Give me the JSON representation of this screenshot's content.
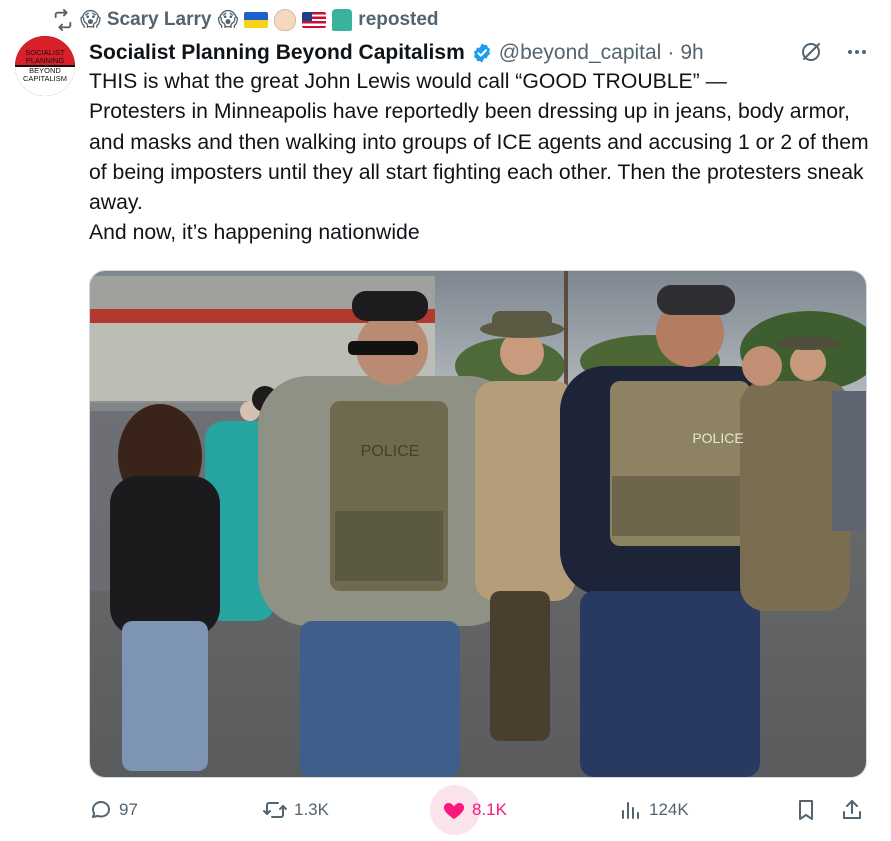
{
  "repost": {
    "user_name": "Scary Larry",
    "label": "reposted",
    "icons": [
      "repost-icon",
      "scream-emoji",
      "ukraine-flag",
      "raised-fist-emoji",
      "us-flag",
      "statue-of-liberty-emoji"
    ]
  },
  "author": {
    "avatar_top_lines": [
      "SOCIALIST",
      "PLANNING"
    ],
    "avatar_bottom_lines": [
      "BEYOND",
      "CAPITALISM"
    ],
    "display_name": "Socialist Planning Beyond Capitalism",
    "handle": "@beyond_capital",
    "separator": "·",
    "time": "9h",
    "verified": true
  },
  "tweet": {
    "text": "THIS is what the great John Lewis would call “GOOD TROUBLE” —\nProtesters in Minneapolis have reportedly been dressing up in jeans, body armor, and masks and then walking into groups of ICE agents and accusing 1 or 2 of them of being imposters until they all start fighting each other. Then the protesters sneak away.\nAnd now, it’s happening nationwide"
  },
  "media": {
    "vest_labels": [
      "POLICE",
      "POLICE"
    ]
  },
  "actions": {
    "replies": "97",
    "reposts": "1.3K",
    "likes": "8.1K",
    "views": "124K"
  },
  "colors": {
    "like": "#f91880",
    "verified": "#1d9bf0",
    "muted": "#536471"
  }
}
